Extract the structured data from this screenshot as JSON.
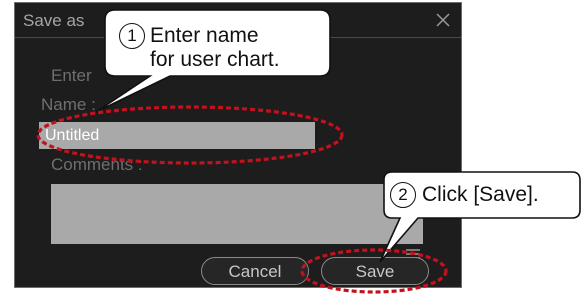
{
  "dialog": {
    "title": "Save as",
    "enter_label": "Enter",
    "name_label": "Name :",
    "name_value": "Untitled",
    "comments_label": "Comments :",
    "cancel_label": "Cancel",
    "save_label": "Save"
  },
  "callouts": {
    "step1_number": "1",
    "step1_line1": "Enter name",
    "step1_line2": "for user chart.",
    "step2_number": "2",
    "step2_text": "Click [Save]."
  },
  "colors": {
    "dialog_bg": "#1d1d1d",
    "field_bg": "#a9a9a9",
    "highlight_dash": "#c1121f"
  },
  "icons": {
    "close": "close-icon",
    "resize": "resize-grip-icon"
  }
}
